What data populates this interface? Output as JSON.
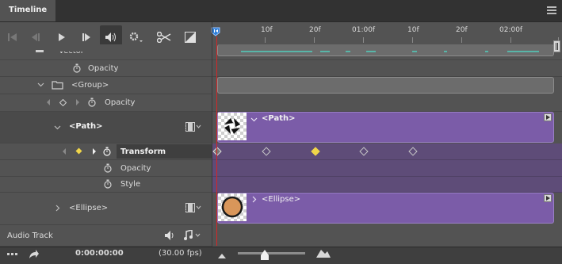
{
  "panel": {
    "tab": "Timeline"
  },
  "icons": {
    "go_first": "go-to-first-frame-icon",
    "prev": "previous-frame-icon",
    "play": "play-icon",
    "next": "next-frame-icon",
    "audio": "speaker-icon",
    "settings": "gear-icon",
    "split": "scissors-icon",
    "transition": "transition-icon"
  },
  "ruler": {
    "labels": [
      "10f",
      "20f",
      "01:00f",
      "10f",
      "20f",
      "02:00f"
    ]
  },
  "layers": {
    "vector_partial": "Vector",
    "opacity1": "Opacity",
    "group": "<Group>",
    "opacity2": "Opacity",
    "path": "<Path>",
    "transform": "Transform",
    "opacity3": "Opacity",
    "style": "Style",
    "ellipse": "<Ellipse>",
    "audio_track": "Audio Track"
  },
  "clips": {
    "path_label": "<Path>",
    "ellipse_label": "<Ellipse>"
  },
  "footer": {
    "timecode": "0:00:00:00",
    "fps": "(30.00 fps)"
  },
  "colors": {
    "playhead": "#d62626",
    "clip_purple": "#7b5ca8",
    "keyframe_active": "#f0d54a",
    "work_area": "#2f7fd8"
  }
}
